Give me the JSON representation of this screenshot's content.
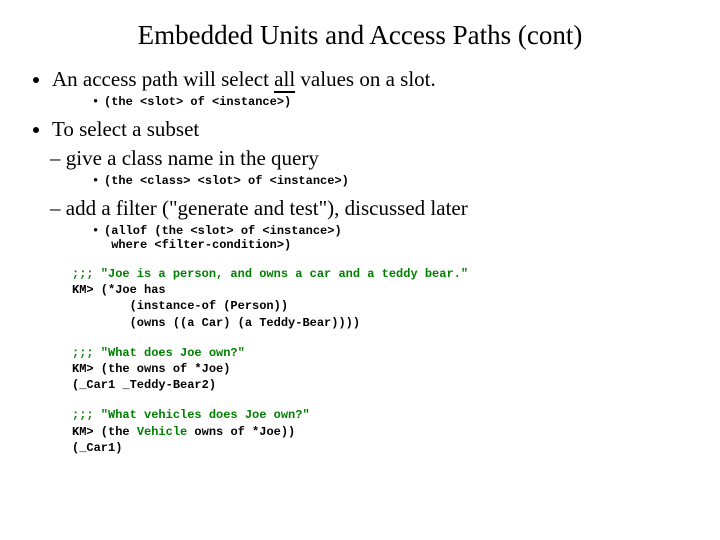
{
  "title": "Embedded Units and Access Paths (cont)",
  "b1_a": "An access path will select ",
  "b1_all": "all",
  "b1_b": " values on a slot.",
  "code1": "(the <slot> of <instance>)",
  "b2": "To select a subset",
  "d1": "give a class name in the query",
  "code2": "(the <class> <slot> of <instance>)",
  "d2": "add a filter (\"generate and test\"), discussed later",
  "code3a": "(allof (the <slot> of <instance>)",
  "code3b": "       where <filter-condition>)",
  "ex1_c": ";;; \"Joe is a person, and owns a car and a teddy bear.\"",
  "ex1_1": "KM> (*Joe has",
  "ex1_2": "        (instance-of (Person))",
  "ex1_3": "        (owns ((a Car) (a Teddy-Bear))))",
  "ex2_c": ";;; \"What does Joe own?\"",
  "ex2_1": "KM> (the owns of *Joe)",
  "ex2_2": "(_Car1 _Teddy-Bear2)",
  "ex3_c": ";;; \"What vehicles does Joe own?\"",
  "ex3_1a": "KM> (the ",
  "ex3_1v": "Vehicle",
  "ex3_1b": " owns of *Joe))",
  "ex3_2": "(_Car1)"
}
